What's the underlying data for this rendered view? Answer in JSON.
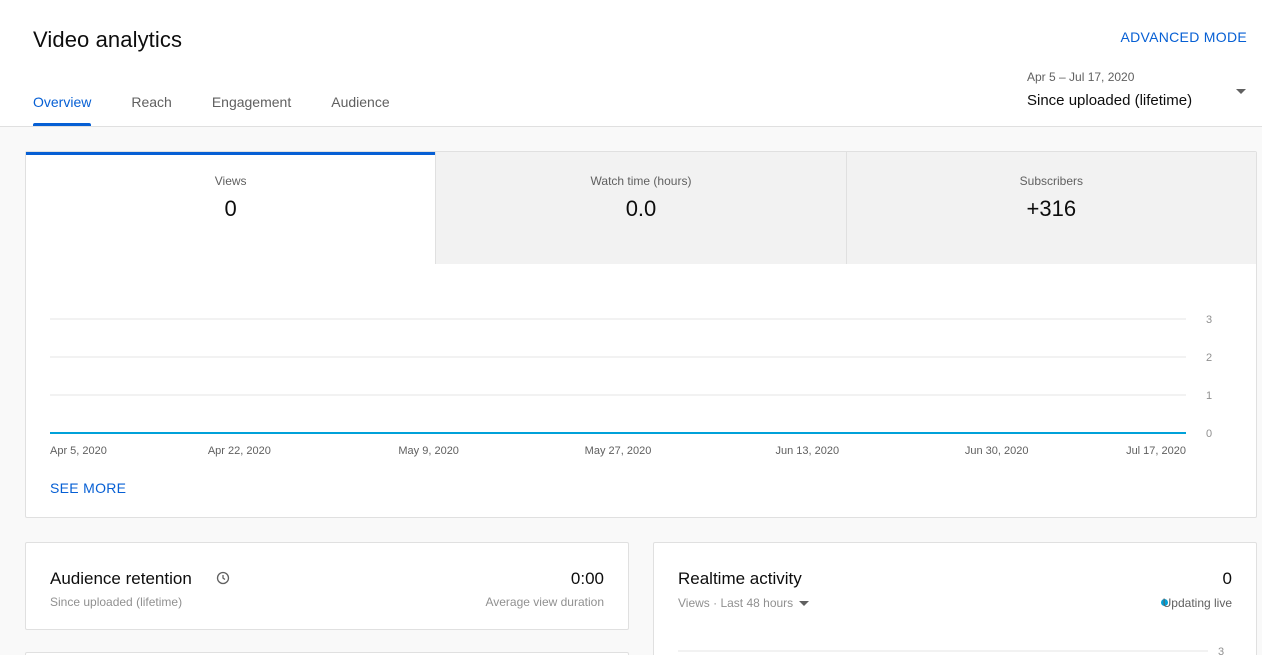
{
  "header": {
    "title": "Video analytics",
    "advanced_mode": "ADVANCED MODE",
    "tabs": [
      {
        "label": "Overview",
        "active": true
      },
      {
        "label": "Reach",
        "active": false
      },
      {
        "label": "Engagement",
        "active": false
      },
      {
        "label": "Audience",
        "active": false
      }
    ],
    "date_range": "Apr 5 – Jul 17, 2020",
    "date_label": "Since uploaded (lifetime)"
  },
  "metrics": [
    {
      "label": "Views",
      "value": "0",
      "active": true
    },
    {
      "label": "Watch time (hours)",
      "value": "0.0",
      "active": false
    },
    {
      "label": "Subscribers",
      "value": "+316",
      "active": false
    }
  ],
  "chart_data": {
    "type": "line",
    "x": [
      "Apr 5, 2020",
      "Apr 22, 2020",
      "May 9, 2020",
      "May 27, 2020",
      "Jun 13, 2020",
      "Jun 30, 2020",
      "Jul 17, 2020"
    ],
    "series": [
      {
        "values": [
          0,
          0,
          0,
          0,
          0,
          0,
          0
        ]
      }
    ],
    "yticks": [
      "0",
      "1",
      "2",
      "3"
    ],
    "ylim": [
      0,
      3
    ],
    "grid": true,
    "line_color": "#00a1d9"
  },
  "see_more": "SEE MORE",
  "retention": {
    "title": "Audience retention",
    "subtitle": "Since uploaded (lifetime)",
    "value": "0:00",
    "value_label": "Average view duration"
  },
  "realtime": {
    "title": "Realtime activity",
    "subtitle": "Views · Last 48 hours",
    "value": "0",
    "live_label": "Updating live",
    "ytick_top": "3"
  },
  "colors": {
    "accent": "#065fd4",
    "live": "#00a1d9"
  }
}
